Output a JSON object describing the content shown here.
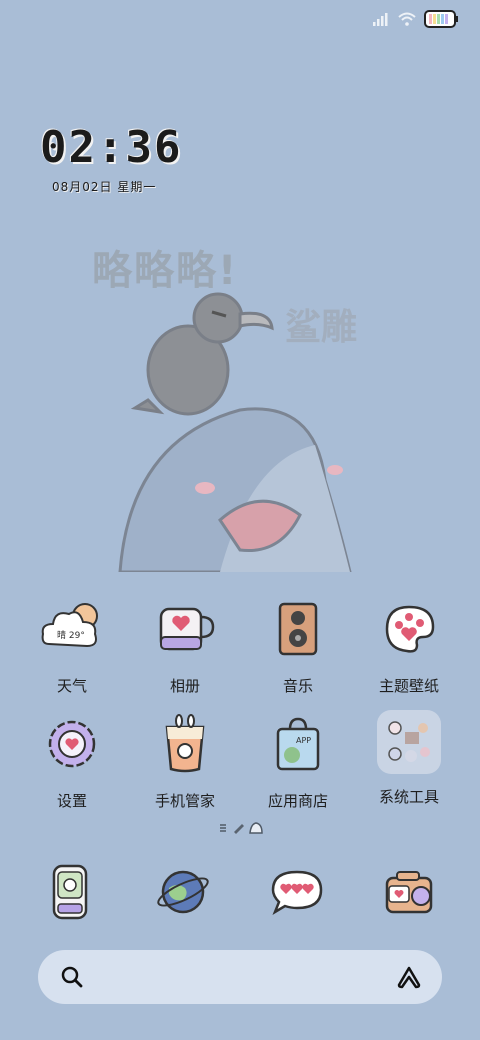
{
  "lock": {
    "time": "02:36",
    "date": "08月02日 星期一"
  },
  "wallpaper": {
    "text_main": "略略略!",
    "text_side": "鲨雕"
  },
  "apps": [
    {
      "label": "天气",
      "icon": "weather-icon",
      "badge": "晴 29°"
    },
    {
      "label": "相册",
      "icon": "album-icon"
    },
    {
      "label": "音乐",
      "icon": "music-icon"
    },
    {
      "label": "主题壁纸",
      "icon": "theme-icon"
    },
    {
      "label": "设置",
      "icon": "settings-icon"
    },
    {
      "label": "手机管家",
      "icon": "phone-manager-icon"
    },
    {
      "label": "应用商店",
      "icon": "app-store-icon",
      "badge": "APP"
    },
    {
      "label": "系统工具",
      "icon": "system-tools-folder-icon"
    }
  ],
  "dock": [
    {
      "icon": "phone-icon"
    },
    {
      "icon": "browser-icon"
    },
    {
      "icon": "messages-icon"
    },
    {
      "icon": "camera-icon"
    }
  ],
  "search": {
    "left_icon": "search-icon",
    "right_icon": "assistant-icon"
  },
  "colors": {
    "background": "#a9bdd6",
    "search_bg": "#d7e1ef",
    "label": "#1e1e1e"
  }
}
